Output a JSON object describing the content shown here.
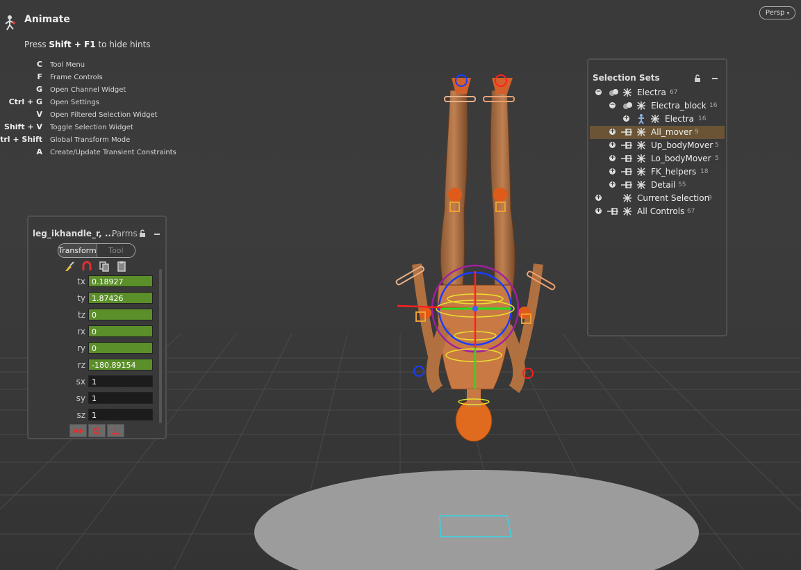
{
  "hud": {
    "title": "Animate",
    "hint_prefix": "Press ",
    "hint_keys": "Shift + F1",
    "hint_suffix": " to hide hints",
    "hotkeys": [
      {
        "key": "C",
        "desc": "Tool Menu"
      },
      {
        "key": "F",
        "desc": "Frame Controls"
      },
      {
        "key": "G",
        "desc": "Open Channel Widget"
      },
      {
        "key": "Ctrl + G",
        "desc": "Open Settings"
      },
      {
        "key": "V",
        "desc": "Open Filtered Selection Widget"
      },
      {
        "key": "Shift + V",
        "desc": "Toggle Selection Widget"
      },
      {
        "key": "Ctrl + Shift",
        "desc": "Global Transform Mode"
      },
      {
        "key": "A",
        "desc": "Create/Update Transient Constraints"
      }
    ]
  },
  "viewport": {
    "camera_menu": "Persp",
    "camera_caret": "▾"
  },
  "parm_panel": {
    "title": "leg_ikhandle_r, ...",
    "mode": "Parms",
    "tabs": [
      {
        "label": "Transform",
        "active": true
      },
      {
        "label": "Tool",
        "active": false
      }
    ],
    "params": [
      {
        "name": "tx",
        "value": "0.18927",
        "keyed": true
      },
      {
        "name": "ty",
        "value": "1.87426",
        "keyed": true
      },
      {
        "name": "tz",
        "value": "0",
        "keyed": true
      },
      {
        "name": "rx",
        "value": "0",
        "keyed": true
      },
      {
        "name": "ry",
        "value": "0",
        "keyed": true
      },
      {
        "name": "rz",
        "value": "-180.89154",
        "keyed": true
      },
      {
        "name": "sx",
        "value": "1",
        "keyed": false
      },
      {
        "name": "sy",
        "value": "1",
        "keyed": false
      },
      {
        "name": "sz",
        "value": "1",
        "keyed": false
      }
    ]
  },
  "selection_sets": {
    "title": "Selection Sets",
    "items": [
      {
        "label": "Electra",
        "count": "67",
        "expander": "−",
        "highlight": false
      },
      {
        "label": "Electra_block",
        "count": "16",
        "expander": "−",
        "highlight": false
      },
      {
        "label": "Electra",
        "count": "16",
        "expander": "+",
        "highlight": false
      },
      {
        "label": "All_mover",
        "count": "9",
        "expander": "+",
        "highlight": true
      },
      {
        "label": "Up_bodyMover",
        "count": "5",
        "expander": "+",
        "highlight": false
      },
      {
        "label": "Lo_bodyMover",
        "count": "5",
        "expander": "+",
        "highlight": false
      },
      {
        "label": "FK_helpers",
        "count": "18",
        "expander": "+",
        "highlight": false
      },
      {
        "label": "Detail",
        "count": "55",
        "expander": "+",
        "highlight": false
      },
      {
        "label": "Current Selection",
        "count": "9",
        "expander": "+",
        "highlight": false
      },
      {
        "label": "All Controls",
        "count": "67",
        "expander": "+",
        "highlight": false
      }
    ]
  },
  "colors": {
    "keyed_field": "#5b8f2a",
    "highlight_row": "#6a5435",
    "character": "#e06a1e",
    "handle_blue": "#1a3cff",
    "handle_red": "#ff2020"
  }
}
